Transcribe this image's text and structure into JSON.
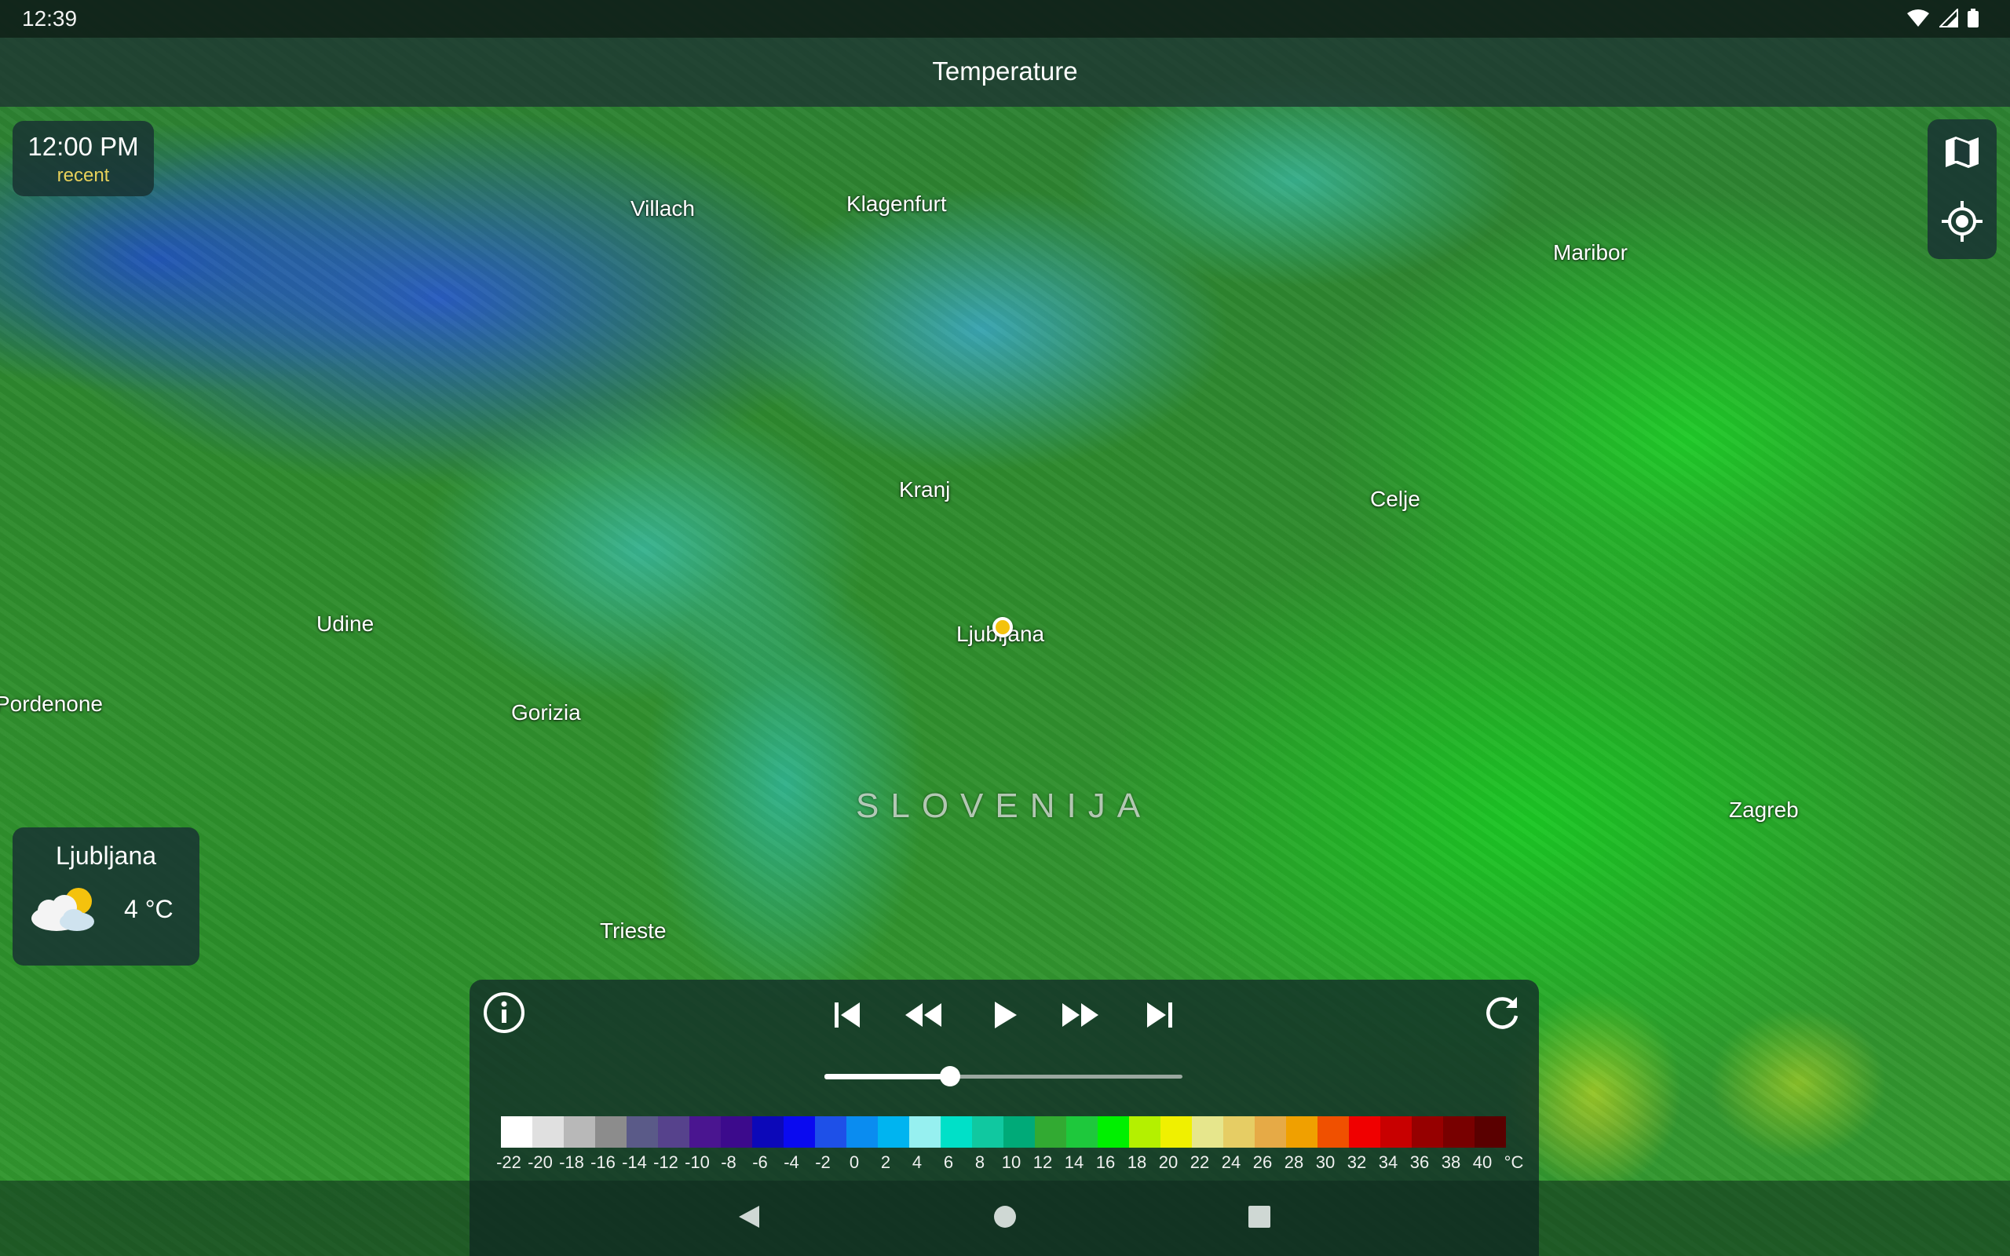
{
  "status_bar": {
    "time": "12:39",
    "icons": [
      "wifi-icon",
      "cellular-signal-icon",
      "battery-icon"
    ]
  },
  "title": "Temperature",
  "time_chip": {
    "time": "12:00 PM",
    "subtitle": "recent"
  },
  "map_controls": [
    "map-layers-icon",
    "my-location-icon"
  ],
  "map": {
    "country_label": "SLOVENIJA",
    "cities": [
      {
        "name": "Villach"
      },
      {
        "name": "Klagenfurt"
      },
      {
        "name": "Maribor"
      },
      {
        "name": "Kranj"
      },
      {
        "name": "Celje"
      },
      {
        "name": "Udine"
      },
      {
        "name": "Ljubljana"
      },
      {
        "name": "Pordenone"
      },
      {
        "name": "Gorizia"
      },
      {
        "name": "Zagreb"
      },
      {
        "name": "Trieste"
      }
    ]
  },
  "weather_card": {
    "city": "Ljubljana",
    "temperature": "4 °C",
    "icon": "partly-cloudy-icon"
  },
  "player": {
    "controls": [
      "info-icon",
      "skip-to-start-icon",
      "rewind-icon",
      "play-icon",
      "fast-forward-icon",
      "skip-to-end-icon",
      "refresh-icon"
    ],
    "timeline_progress": 0.35
  },
  "legend": {
    "unit": "°C",
    "labels": [
      "-22",
      "-20",
      "-18",
      "-16",
      "-14",
      "-12",
      "-10",
      "-8",
      "-6",
      "-4",
      "-2",
      "0",
      "2",
      "4",
      "6",
      "8",
      "10",
      "12",
      "14",
      "16",
      "18",
      "20",
      "22",
      "24",
      "26",
      "28",
      "30",
      "32",
      "34",
      "36",
      "38",
      "40"
    ],
    "colors": [
      "#ffffff",
      "#e0e0e0",
      "#b8b8b8",
      "#8c8c8c",
      "#5a5a88",
      "#56428c",
      "#4a1590",
      "#3c0a8c",
      "#0c08b8",
      "#0a0af0",
      "#1e50e8",
      "#0a8cf0",
      "#00b4f0",
      "#96f0f0",
      "#00e0c8",
      "#10c8a0",
      "#00aa78",
      "#32aa32",
      "#1ec83c",
      "#00f000",
      "#b4f000",
      "#f0f000",
      "#e6e68c",
      "#e6cd64",
      "#e6aa46",
      "#f0a000",
      "#f05000",
      "#f00000",
      "#c80000",
      "#960000",
      "#780000",
      "#5a0000"
    ]
  },
  "nav_bar": [
    "back-icon",
    "home-icon",
    "recents-icon"
  ]
}
